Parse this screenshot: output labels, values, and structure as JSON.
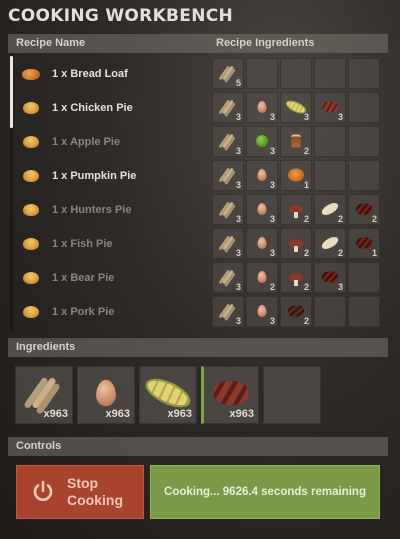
{
  "title": "COOKING WORKBENCH",
  "recipes_header": {
    "name_col": "Recipe Name",
    "ingredients_col": "Recipe Ingredients"
  },
  "recipes": [
    {
      "label": "1 x Bread Loaf",
      "icon": "bread-loaf-icon",
      "available": true,
      "ingredients": [
        {
          "icon": "wheat-icon",
          "qty": "5"
        }
      ]
    },
    {
      "label": "1 x Chicken Pie",
      "icon": "chicken-pie-icon",
      "available": true,
      "ingredients": [
        {
          "icon": "wheat-icon",
          "qty": "3"
        },
        {
          "icon": "egg-icon",
          "qty": "3"
        },
        {
          "icon": "corn-icon",
          "qty": "3"
        },
        {
          "icon": "chicken-meat-icon",
          "qty": "3"
        }
      ]
    },
    {
      "label": "1 x Apple Pie",
      "icon": "apple-pie-icon",
      "available": false,
      "ingredients": [
        {
          "icon": "wheat-icon",
          "qty": "3"
        },
        {
          "icon": "apple-icon",
          "qty": "3"
        },
        {
          "icon": "jar-icon",
          "qty": "2"
        }
      ]
    },
    {
      "label": "1 x Pumpkin Pie",
      "icon": "pumpkin-pie-icon",
      "available": true,
      "ingredients": [
        {
          "icon": "wheat-icon",
          "qty": "3"
        },
        {
          "icon": "egg-icon",
          "qty": "3"
        },
        {
          "icon": "pumpkin-icon",
          "qty": "1"
        }
      ]
    },
    {
      "label": "1 x Hunters Pie",
      "icon": "hunters-pie-icon",
      "available": false,
      "ingredients": [
        {
          "icon": "wheat-icon",
          "qty": "3"
        },
        {
          "icon": "egg-icon",
          "qty": "3"
        },
        {
          "icon": "mushroom-icon",
          "qty": "2"
        },
        {
          "icon": "fish-icon",
          "qty": "2"
        },
        {
          "icon": "bear-meat-icon",
          "qty": "2"
        }
      ]
    },
    {
      "label": "1 x Fish Pie",
      "icon": "fish-pie-icon",
      "available": false,
      "ingredients": [
        {
          "icon": "wheat-icon",
          "qty": "3"
        },
        {
          "icon": "egg-icon",
          "qty": "3"
        },
        {
          "icon": "mushroom-icon",
          "qty": "2"
        },
        {
          "icon": "fish-icon",
          "qty": "2"
        },
        {
          "icon": "raw-meat-icon",
          "qty": "1"
        }
      ]
    },
    {
      "label": "1 x Bear Pie",
      "icon": "bear-pie-icon",
      "available": false,
      "ingredients": [
        {
          "icon": "wheat-icon",
          "qty": "3"
        },
        {
          "icon": "egg-icon",
          "qty": "2"
        },
        {
          "icon": "mushroom-icon",
          "qty": "2"
        },
        {
          "icon": "bear-meat-icon",
          "qty": "3"
        }
      ]
    },
    {
      "label": "1 x Pork Pie",
      "icon": "pork-pie-icon",
      "available": false,
      "ingredients": [
        {
          "icon": "wheat-icon",
          "qty": "3"
        },
        {
          "icon": "egg-icon",
          "qty": "3"
        },
        {
          "icon": "pork-meat-icon",
          "qty": "2"
        }
      ]
    }
  ],
  "ingredients_section": {
    "header": "Ingredients",
    "slots": [
      {
        "icon": "wheat-icon",
        "qty": "x963",
        "selected": false
      },
      {
        "icon": "egg-icon",
        "qty": "x963",
        "selected": false
      },
      {
        "icon": "corn-icon",
        "qty": "x963",
        "selected": false
      },
      {
        "icon": "chicken-meat-icon",
        "qty": "x963",
        "selected": true
      },
      {
        "icon": "empty-slot",
        "qty": "",
        "selected": false
      }
    ]
  },
  "controls": {
    "header": "Controls",
    "stop_label": "Stop Cooking",
    "status": "Cooking... 9626.4 seconds remaining"
  },
  "colors": {
    "stop": "#a8432e",
    "status": "#7a9a48",
    "selected_accent": "#7fa845"
  }
}
